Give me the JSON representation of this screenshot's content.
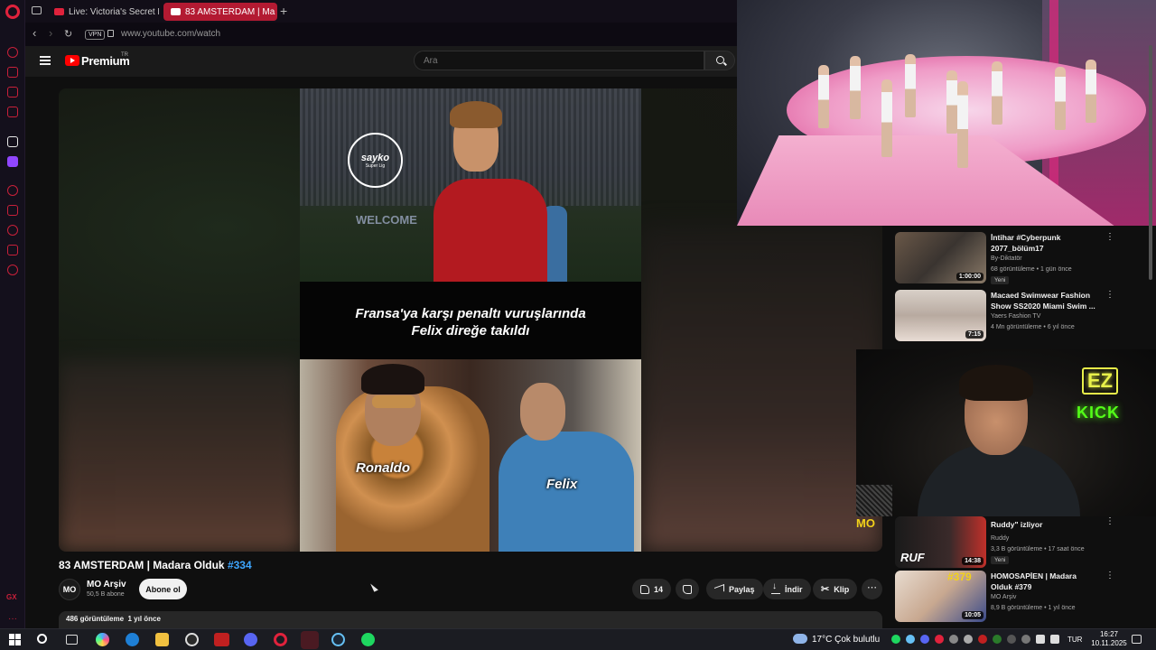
{
  "tabs": [
    {
      "label": "Live: Victoria's Secret Fas",
      "active": false
    },
    {
      "label": "83 AMSTERDAM | Ma",
      "active": true
    }
  ],
  "address": {
    "vpn": "VPN",
    "url": "www.youtube.com/watch"
  },
  "yt_header": {
    "brand": "Premium",
    "brand_sup": "TR",
    "search_placeholder": "Ara"
  },
  "video": {
    "overlay_logo": "sayko",
    "overlay_logo_sub": "Super Lig",
    "welcome_text": "WELCOME",
    "caption_line1": "Fransa'ya karşı penaltı vuruşlarında",
    "caption_line2": "Felix direğe takıldı",
    "label_left": "Ronaldo",
    "label_right": "Felix"
  },
  "title": {
    "main": "83 AMSTERDAM | Madara Olduk ",
    "hashtag": "#334"
  },
  "channel": {
    "avatar": "MO",
    "name": "MO Arşiv",
    "subs": "50,5 B abone",
    "subscribe": "Abone ol"
  },
  "actions": {
    "likes": "14",
    "share": "Paylaş",
    "download": "İndir",
    "clip": "Klip",
    "more": "⋯"
  },
  "description": {
    "views": "486 görüntüleme",
    "age": "1 yıl önce"
  },
  "recommendations": [
    {
      "title": "İntihar #Cyberpunk 2077_bölüm17",
      "channel": "By-Diktatör",
      "meta": "68 görüntüleme • 1 gün önce",
      "badge": "Yeni",
      "duration": "1:00:00"
    },
    {
      "title": "Macaed Swimwear Fashion Show SS2020 Miami Swim ...",
      "channel": "Yaers Fashion TV",
      "meta": "4 Mn görüntüleme • 6 yıl önce",
      "badge": "",
      "duration": "7:15"
    },
    {
      "title": "Ruddy\" izliyor",
      "channel": "Ruddy",
      "meta": "3,3 B görüntüleme • 17 saat önce",
      "badge": "Yeni",
      "duration": "14:38",
      "thumb_text": "RUF"
    },
    {
      "title": "HOMOSAPİEN | Madara Olduk #379",
      "channel": "MO Arşiv",
      "meta": "8,9 B görüntüleme • 1 yıl önce",
      "badge": "",
      "duration": "10:05",
      "thumb_text": "#379"
    }
  ],
  "webcam": {
    "neon1": "EZ",
    "neon2": "KICK",
    "corner_logo": "MO"
  },
  "taskbar": {
    "weather": "17°C  Çok bulutlu",
    "lang": "TUR",
    "time": "16:27",
    "date": "10.11.2025"
  },
  "sidebar": {
    "gx": "GX",
    "dots": "···"
  },
  "colors": {
    "opera_red": "#e0223c",
    "yt_red": "#ff0000",
    "link_blue": "#3ea6ff",
    "kick_green": "#53fc18"
  }
}
